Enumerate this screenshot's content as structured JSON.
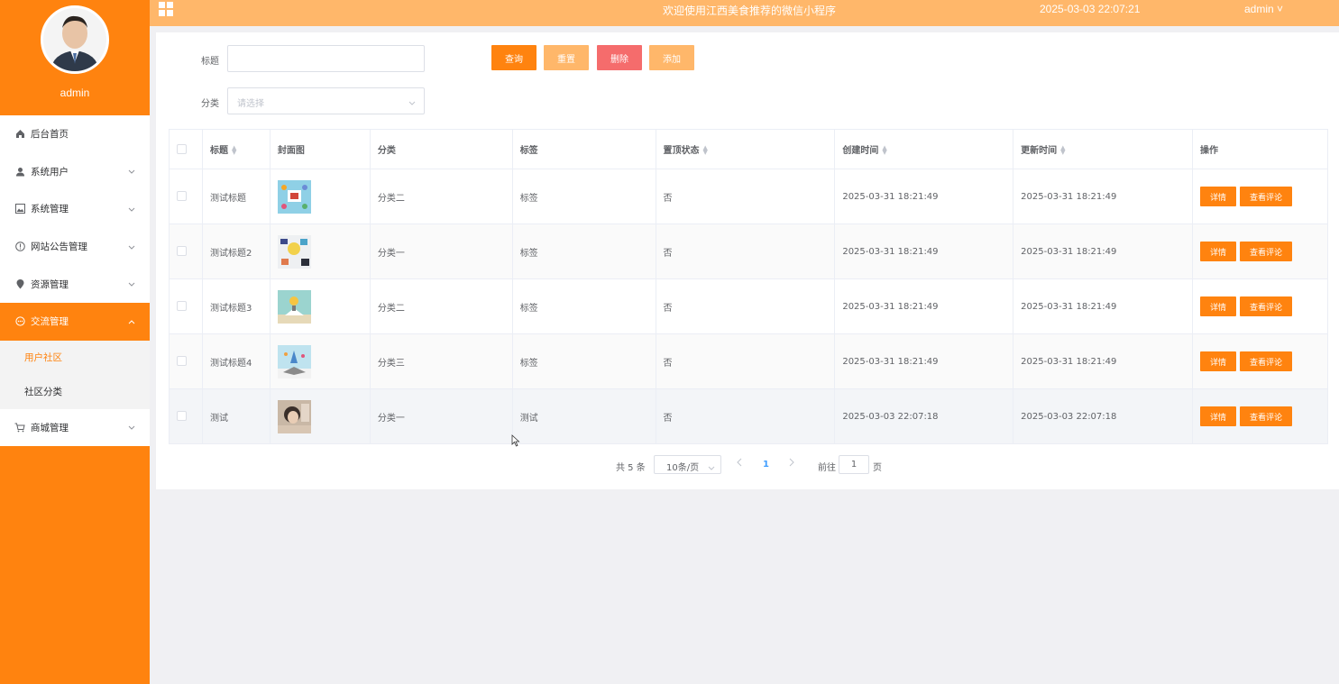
{
  "header": {
    "title": "欢迎使用江西美食推荐的微信小程序",
    "datetime": "2025-03-03 22:07:21",
    "user": "admin ˅"
  },
  "profile": {
    "name": "admin"
  },
  "menu": [
    {
      "label": "后台首页",
      "icon": "home-icon"
    },
    {
      "label": "系统用户",
      "icon": "user-icon"
    },
    {
      "label": "系统管理",
      "icon": "image-icon"
    },
    {
      "label": "网站公告管理",
      "icon": "info-icon"
    },
    {
      "label": "资源管理",
      "icon": "location-icon"
    },
    {
      "label": "交流管理",
      "icon": "chat-icon"
    },
    {
      "label": "商城管理",
      "icon": "cart-icon"
    }
  ],
  "submenu": [
    {
      "label": "用户社区"
    },
    {
      "label": "社区分类"
    }
  ],
  "filters": {
    "title_label": "标题",
    "title_value": "",
    "category_label": "分类",
    "category_placeholder": "请选择"
  },
  "buttons": {
    "search": "查询",
    "reset": "重置",
    "delete": "删除",
    "add": "添加"
  },
  "colors": {
    "primary": "#ff830f",
    "header": "#ffb76a",
    "reset_button": "#ffb76a",
    "delete_button": "#f56c6c",
    "link": "#409eff"
  },
  "table": {
    "columns": [
      "标题",
      "封面图",
      "分类",
      "标签",
      "置顶状态",
      "创建时间",
      "更新时间",
      "操作"
    ],
    "rows": [
      {
        "title": "测试标题",
        "category": "分类二",
        "tag": "标签",
        "pinned": "否",
        "created": "2025-03-31 18:21:49",
        "updated": "2025-03-31 18:21:49",
        "detail": "详情",
        "comments": "查看评论"
      },
      {
        "title": "测试标题2",
        "category": "分类一",
        "tag": "标签",
        "pinned": "否",
        "created": "2025-03-31 18:21:49",
        "updated": "2025-03-31 18:21:49",
        "detail": "详情",
        "comments": "查看评论"
      },
      {
        "title": "测试标题3",
        "category": "分类二",
        "tag": "标签",
        "pinned": "否",
        "created": "2025-03-31 18:21:49",
        "updated": "2025-03-31 18:21:49",
        "detail": "详情",
        "comments": "查看评论"
      },
      {
        "title": "测试标题4",
        "category": "分类三",
        "tag": "标签",
        "pinned": "否",
        "created": "2025-03-31 18:21:49",
        "updated": "2025-03-31 18:21:49",
        "detail": "详情",
        "comments": "查看评论"
      },
      {
        "title": "测试",
        "category": "分类一",
        "tag": "测试",
        "pinned": "否",
        "created": "2025-03-03 22:07:18",
        "updated": "2025-03-03 22:07:18",
        "detail": "详情",
        "comments": "查看评论"
      }
    ]
  },
  "pagination": {
    "total": "共 5 条",
    "page_size": "10条/页",
    "current_page": "1",
    "goto_label": "前往",
    "goto_value": "1",
    "page_suffix": "页"
  }
}
